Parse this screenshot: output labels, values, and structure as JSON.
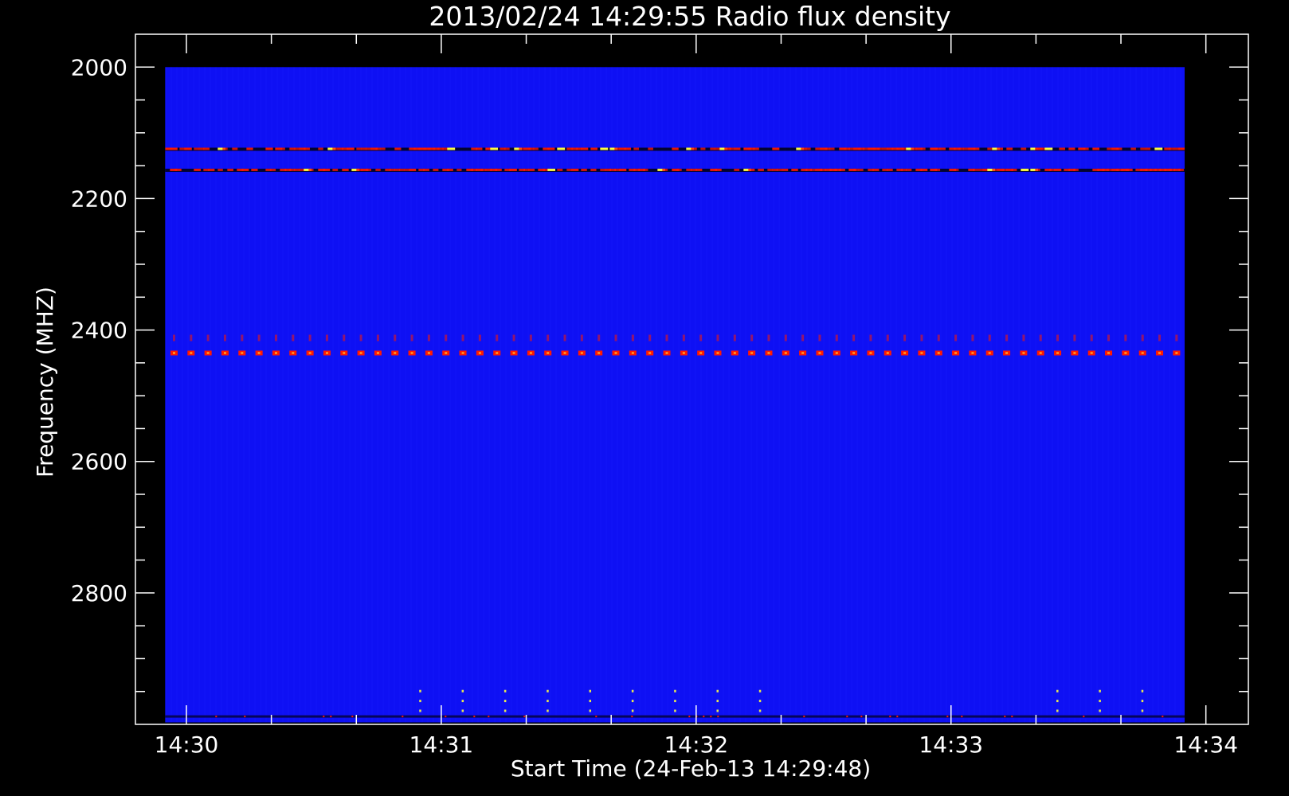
{
  "chart_data": {
    "type": "heatmap",
    "title": "2013/02/24 14:29:55 Radio flux density",
    "xlabel": "Start Time (24-Feb-13 14:29:48)",
    "ylabel": "Frequency (MHZ)",
    "x_ticks": [
      "14:30",
      "14:31",
      "14:32",
      "14:33",
      "14:34"
    ],
    "y_ticks": [
      "2000",
      "2200",
      "2400",
      "2600",
      "2800"
    ],
    "xlim": [
      "14:29:48",
      "14:34:10"
    ],
    "ylim": [
      1950,
      3000
    ],
    "data_extent": {
      "time_start": "14:29:55",
      "time_end": "14:33:55",
      "freq_start": 2000,
      "freq_end": 2997
    },
    "colormap": {
      "background": "#0e10f4",
      "hot": "#ff1a00",
      "highlight": "#ffff40",
      "dark": "#000000"
    },
    "features": {
      "continuous_lines": [
        {
          "freq": 2125,
          "intensity": "hot"
        },
        {
          "freq": 2157,
          "intensity": "hot"
        }
      ],
      "pulsed_lines": [
        {
          "freq": 2435,
          "intensity": "hot"
        },
        {
          "freq": 2412,
          "intensity": "weak"
        }
      ],
      "bottom_edge_freq": 2988,
      "bottom_dot_times": [
        "14:30:55",
        "14:31:05",
        "14:31:15",
        "14:31:25",
        "14:31:35",
        "14:31:45",
        "14:31:55",
        "14:32:05",
        "14:32:15",
        "14:33:25",
        "14:33:35",
        "14:33:45"
      ]
    }
  }
}
